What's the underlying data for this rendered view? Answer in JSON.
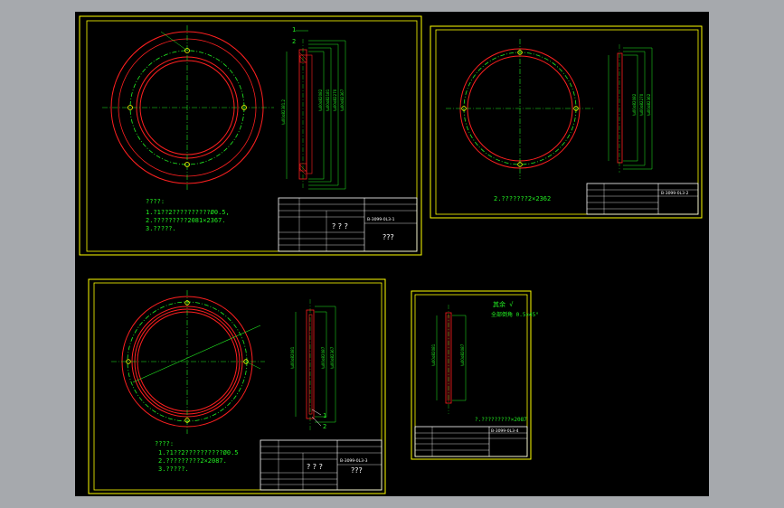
{
  "colors": {
    "background": "#000000",
    "frame": "#ffff00",
    "outline": "#ff2020",
    "centerline": "#22ee22",
    "hatch": "#ff2020",
    "text": "#ffffff"
  },
  "sheet1": {
    "notes": [
      "????:",
      "1.?1??2??????????Ø0.5,",
      "2.?????????2081×2367.",
      "3.?????."
    ],
    "title_code": "B-3099-0L3-1",
    "title_name": "? ? ?",
    "title_extra": "???",
    "balloons": [
      "1",
      "2"
    ]
  },
  "sheet2": {
    "note": "2.???????2×2362",
    "title_code": "B-3099-0L3-2"
  },
  "sheet3": {
    "notes": [
      "????:",
      "1.?1??2??????????Ø0.5",
      "2.?????????2×2087.",
      "3.?????."
    ],
    "title_code": "B-3099-0L3-3",
    "title_name": "? ? ?",
    "title_extra": "???",
    "balloons": [
      "1",
      "2"
    ]
  },
  "sheet4": {
    "top_note_1": "其余 √",
    "top_note_2": "全部倒角 0.5×45°",
    "note": "?.?????????×2087",
    "title_code": "B-3099-0L3-4"
  }
}
